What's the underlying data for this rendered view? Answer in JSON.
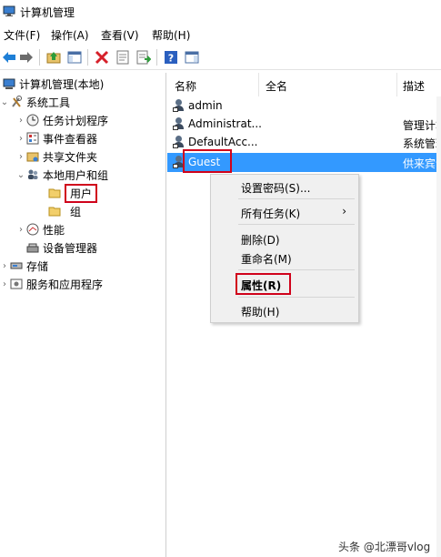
{
  "window": {
    "title": "计算机管理"
  },
  "menubar": [
    "文件(F)",
    "操作(A)",
    "查看(V)",
    "帮助(H)"
  ],
  "toolbar": {
    "icons": [
      "back-arrow-icon",
      "forward-arrow-icon",
      "up-folder-icon",
      "show-hide-tree-icon",
      "delete-icon",
      "properties-icon",
      "export-list-icon",
      "help-icon",
      "toggle-action-pane-icon"
    ],
    "colors": {
      "back": "#1e7fd6",
      "delete": "#d6202a",
      "help": "#2a5fbf"
    }
  },
  "tree": {
    "root": "计算机管理(本地)",
    "system_tools": "系统工具",
    "task_scheduler": "任务计划程序",
    "event_viewer": "事件查看器",
    "shared_folders": "共享文件夹",
    "local_users_groups": "本地用户和组",
    "users": "用户",
    "groups": "组",
    "performance": "性能",
    "device_manager": "设备管理器",
    "storage": "存储",
    "services_apps": "服务和应用程序"
  },
  "list": {
    "columns": [
      "名称",
      "全名",
      "描述"
    ],
    "rows": [
      {
        "name": "admin",
        "description": ""
      },
      {
        "name": "Administrat...",
        "description": "管理计算"
      },
      {
        "name": "DefaultAcc...",
        "description": "系统管理"
      },
      {
        "name": "Guest",
        "description": "供来宾访"
      }
    ],
    "selected_row": 3,
    "selection_color": "#3399ff"
  },
  "context_menu": {
    "items": [
      "设置密码(S)...",
      "所有任务(K)",
      "删除(D)",
      "重命名(M)",
      "属性(R)",
      "帮助(H)"
    ],
    "submenu_arrow": "›"
  },
  "highlight_color": "#d0021b",
  "watermark": "头条 @北漂哥vlog"
}
